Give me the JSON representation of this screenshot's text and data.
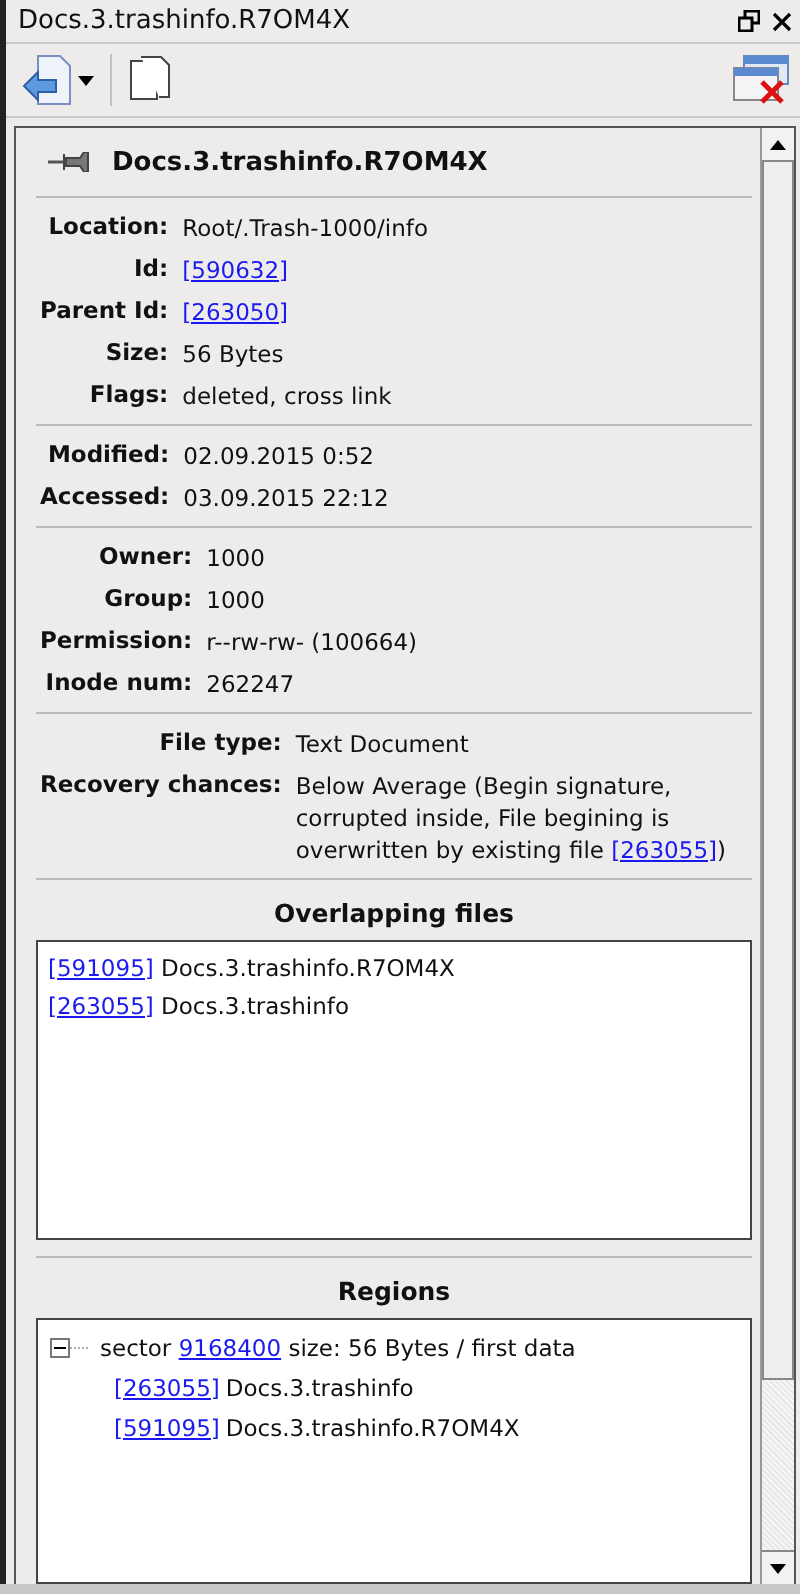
{
  "window": {
    "title": "Docs.3.trashinfo.R7OM4X"
  },
  "header": {
    "name": "Docs.3.trashinfo.R7OM4X"
  },
  "sections": [
    {
      "fields": [
        {
          "label": "Location:",
          "value": [
            {
              "text": "Root/.Trash-1000/info",
              "link": false
            }
          ]
        },
        {
          "label": "Id:",
          "value": [
            {
              "text": "[590632]",
              "link": true
            }
          ]
        },
        {
          "label": "Parent Id:",
          "value": [
            {
              "text": "[263050]",
              "link": true
            }
          ]
        },
        {
          "label": "Size:",
          "value": [
            {
              "text": "56 Bytes",
              "link": false
            }
          ]
        },
        {
          "label": "Flags:",
          "value": [
            {
              "text": "deleted, cross link",
              "link": false
            }
          ]
        }
      ]
    },
    {
      "fields": [
        {
          "label": "Modified:",
          "value": [
            {
              "text": "02.09.2015 0:52",
              "link": false
            }
          ]
        },
        {
          "label": "Accessed:",
          "value": [
            {
              "text": "03.09.2015 22:12",
              "link": false
            }
          ]
        }
      ]
    },
    {
      "fields": [
        {
          "label": "Owner:",
          "value": [
            {
              "text": "1000",
              "link": false
            }
          ]
        },
        {
          "label": "Group:",
          "value": [
            {
              "text": "1000",
              "link": false
            }
          ]
        },
        {
          "label": "Permission:",
          "value": [
            {
              "text": "r--rw-rw- (100664)",
              "link": false
            }
          ]
        },
        {
          "label": "Inode num:",
          "value": [
            {
              "text": "262247",
              "link": false
            }
          ]
        }
      ]
    },
    {
      "fields": [
        {
          "label": "File type:",
          "value": [
            {
              "text": "Text Document",
              "link": false
            }
          ]
        },
        {
          "label": "Recovery chances:",
          "value": [
            {
              "text": "Below Average (Begin signature, corrupted inside, File begining is overwritten by existing file ",
              "link": false
            },
            {
              "text": "[263055]",
              "link": true
            },
            {
              "text": ")",
              "link": false
            }
          ]
        }
      ]
    }
  ],
  "overlapping_files": {
    "title": "Overlapping files",
    "items": [
      {
        "id": "[591095]",
        "name": "Docs.3.trashinfo.R7OM4X"
      },
      {
        "id": "[263055]",
        "name": "Docs.3.trashinfo"
      }
    ]
  },
  "regions": {
    "title": "Regions",
    "items": [
      {
        "expanded": true,
        "label": [
          {
            "text": "sector ",
            "link": false
          },
          {
            "text": "9168400",
            "link": true
          },
          {
            "text": " size: 56 Bytes / first data",
            "link": false
          }
        ],
        "children": [
          {
            "id": "[263055]",
            "name": "Docs.3.trashinfo"
          },
          {
            "id": "[591095]",
            "name": "Docs.3.trashinfo.R7OM4X"
          }
        ]
      }
    ]
  }
}
